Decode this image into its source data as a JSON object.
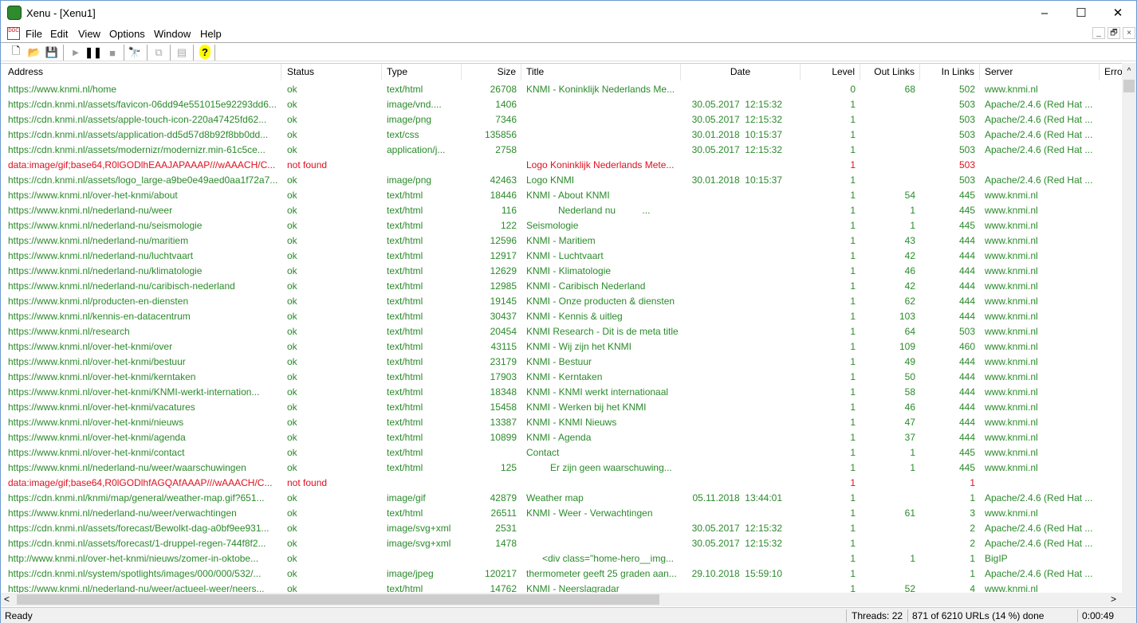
{
  "window": {
    "title": "Xenu - [Xenu1]",
    "minimize": "–",
    "maximize": "☐",
    "close": "✕"
  },
  "menu": [
    "File",
    "Edit",
    "View",
    "Options",
    "Window",
    "Help"
  ],
  "mdi": {
    "minimize": "_",
    "restore": "🗗",
    "close": "×"
  },
  "toolbar": [
    "new-icon",
    "open-icon",
    "save-icon",
    "play-icon",
    "pause-icon",
    "stop-icon",
    "find-icon",
    "copy-icon",
    "properties-icon",
    "help-icon"
  ],
  "columns": [
    "Address",
    "Status",
    "Type",
    "Size",
    "Title",
    "Date",
    "Level",
    "Out Links",
    "In Links",
    "Server",
    "Erro"
  ],
  "colors": {
    "ok": "#2b8a2b",
    "error": "#e0101e"
  },
  "rows": [
    {
      "s": "ok",
      "address": "https://www.knmi.nl/home",
      "status": "ok",
      "type": "text/html",
      "size": "26708",
      "title": "KNMI - Koninklijk Nederlands Me...",
      "date": "",
      "level": "0",
      "out": "68",
      "in": "502",
      "server": "www.knmi.nl"
    },
    {
      "s": "ok",
      "address": "https://cdn.knmi.nl/assets/favicon-06dd94e551015e92293dd6...",
      "status": "ok",
      "type": "image/vnd....",
      "size": "1406",
      "title": "",
      "date": "30.05.2017  12:15:32",
      "level": "1",
      "out": "",
      "in": "503",
      "server": "Apache/2.4.6 (Red Hat ..."
    },
    {
      "s": "ok",
      "address": "https://cdn.knmi.nl/assets/apple-touch-icon-220a47425fd62...",
      "status": "ok",
      "type": "image/png",
      "size": "7346",
      "title": "",
      "date": "30.05.2017  12:15:32",
      "level": "1",
      "out": "",
      "in": "503",
      "server": "Apache/2.4.6 (Red Hat ..."
    },
    {
      "s": "ok",
      "address": "https://cdn.knmi.nl/assets/application-dd5d57d8b92f8bb0dd...",
      "status": "ok",
      "type": "text/css",
      "size": "135856",
      "title": "",
      "date": "30.01.2018  10:15:37",
      "level": "1",
      "out": "",
      "in": "503",
      "server": "Apache/2.4.6 (Red Hat ..."
    },
    {
      "s": "ok",
      "address": "https://cdn.knmi.nl/assets/modernizr/modernizr.min-61c5ce...",
      "status": "ok",
      "type": "application/j...",
      "size": "2758",
      "title": "",
      "date": "30.05.2017  12:15:32",
      "level": "1",
      "out": "",
      "in": "503",
      "server": "Apache/2.4.6 (Red Hat ..."
    },
    {
      "s": "err",
      "address": "data:image/gif;base64,R0lGODlhEAAJAPAAAP///wAAACH/C...",
      "status": "not found",
      "type": "",
      "size": "",
      "title": "Logo Koninklijk Nederlands Mete...",
      "date": "",
      "level": "1",
      "out": "",
      "in": "503",
      "server": ""
    },
    {
      "s": "ok",
      "address": "https://cdn.knmi.nl/assets/logo_large-a9be0e49aed0aa1f72a7...",
      "status": "ok",
      "type": "image/png",
      "size": "42463",
      "title": "Logo KNMI",
      "date": "30.01.2018  10:15:37",
      "level": "1",
      "out": "",
      "in": "503",
      "server": "Apache/2.4.6 (Red Hat ..."
    },
    {
      "s": "ok",
      "address": "https://www.knmi.nl/over-het-knmi/about",
      "status": "ok",
      "type": "text/html",
      "size": "18446",
      "title": "KNMI - About KNMI",
      "date": "",
      "level": "1",
      "out": "54",
      "in": "445",
      "server": "www.knmi.nl"
    },
    {
      "s": "ok",
      "address": "https://www.knmi.nl/nederland-nu/weer",
      "status": "ok",
      "type": "text/html",
      "size": "116",
      "title": "            Nederland nu          ...",
      "date": "",
      "level": "1",
      "out": "1",
      "in": "445",
      "server": "www.knmi.nl"
    },
    {
      "s": "ok",
      "address": "https://www.knmi.nl/nederland-nu/seismologie",
      "status": "ok",
      "type": "text/html",
      "size": "122",
      "title": "Seismologie",
      "date": "",
      "level": "1",
      "out": "1",
      "in": "445",
      "server": "www.knmi.nl"
    },
    {
      "s": "ok",
      "address": "https://www.knmi.nl/nederland-nu/maritiem",
      "status": "ok",
      "type": "text/html",
      "size": "12596",
      "title": "KNMI - Maritiem",
      "date": "",
      "level": "1",
      "out": "43",
      "in": "444",
      "server": "www.knmi.nl"
    },
    {
      "s": "ok",
      "address": "https://www.knmi.nl/nederland-nu/luchtvaart",
      "status": "ok",
      "type": "text/html",
      "size": "12917",
      "title": "KNMI - Luchtvaart",
      "date": "",
      "level": "1",
      "out": "42",
      "in": "444",
      "server": "www.knmi.nl"
    },
    {
      "s": "ok",
      "address": "https://www.knmi.nl/nederland-nu/klimatologie",
      "status": "ok",
      "type": "text/html",
      "size": "12629",
      "title": "KNMI - Klimatologie",
      "date": "",
      "level": "1",
      "out": "46",
      "in": "444",
      "server": "www.knmi.nl"
    },
    {
      "s": "ok",
      "address": "https://www.knmi.nl/nederland-nu/caribisch-nederland",
      "status": "ok",
      "type": "text/html",
      "size": "12985",
      "title": "KNMI - Caribisch Nederland",
      "date": "",
      "level": "1",
      "out": "42",
      "in": "444",
      "server": "www.knmi.nl"
    },
    {
      "s": "ok",
      "address": "https://www.knmi.nl/producten-en-diensten",
      "status": "ok",
      "type": "text/html",
      "size": "19145",
      "title": "KNMI - Onze producten & diensten",
      "date": "",
      "level": "1",
      "out": "62",
      "in": "444",
      "server": "www.knmi.nl"
    },
    {
      "s": "ok",
      "address": "https://www.knmi.nl/kennis-en-datacentrum",
      "status": "ok",
      "type": "text/html",
      "size": "30437",
      "title": "KNMI - Kennis & uitleg",
      "date": "",
      "level": "1",
      "out": "103",
      "in": "444",
      "server": "www.knmi.nl"
    },
    {
      "s": "ok",
      "address": "https://www.knmi.nl/research",
      "status": "ok",
      "type": "text/html",
      "size": "20454",
      "title": "KNMI Research - Dit is de meta title",
      "date": "",
      "level": "1",
      "out": "64",
      "in": "503",
      "server": "www.knmi.nl"
    },
    {
      "s": "ok",
      "address": "https://www.knmi.nl/over-het-knmi/over",
      "status": "ok",
      "type": "text/html",
      "size": "43115",
      "title": "KNMI - Wij zijn het KNMI",
      "date": "",
      "level": "1",
      "out": "109",
      "in": "460",
      "server": "www.knmi.nl"
    },
    {
      "s": "ok",
      "address": "https://www.knmi.nl/over-het-knmi/bestuur",
      "status": "ok",
      "type": "text/html",
      "size": "23179",
      "title": "KNMI - Bestuur",
      "date": "",
      "level": "1",
      "out": "49",
      "in": "444",
      "server": "www.knmi.nl"
    },
    {
      "s": "ok",
      "address": "https://www.knmi.nl/over-het-knmi/kerntaken",
      "status": "ok",
      "type": "text/html",
      "size": "17903",
      "title": "KNMI - Kerntaken",
      "date": "",
      "level": "1",
      "out": "50",
      "in": "444",
      "server": "www.knmi.nl"
    },
    {
      "s": "ok",
      "address": "https://www.knmi.nl/over-het-knmi/KNMI-werkt-internation...",
      "status": "ok",
      "type": "text/html",
      "size": "18348",
      "title": "KNMI - KNMI werkt internationaal",
      "date": "",
      "level": "1",
      "out": "58",
      "in": "444",
      "server": "www.knmi.nl"
    },
    {
      "s": "ok",
      "address": "https://www.knmi.nl/over-het-knmi/vacatures",
      "status": "ok",
      "type": "text/html",
      "size": "15458",
      "title": "KNMI - Werken bij het KNMI",
      "date": "",
      "level": "1",
      "out": "46",
      "in": "444",
      "server": "www.knmi.nl"
    },
    {
      "s": "ok",
      "address": "https://www.knmi.nl/over-het-knmi/nieuws",
      "status": "ok",
      "type": "text/html",
      "size": "13387",
      "title": "KNMI - KNMI Nieuws",
      "date": "",
      "level": "1",
      "out": "47",
      "in": "444",
      "server": "www.knmi.nl"
    },
    {
      "s": "ok",
      "address": "https://www.knmi.nl/over-het-knmi/agenda",
      "status": "ok",
      "type": "text/html",
      "size": "10899",
      "title": "KNMI - Agenda",
      "date": "",
      "level": "1",
      "out": "37",
      "in": "444",
      "server": "www.knmi.nl"
    },
    {
      "s": "ok",
      "address": "https://www.knmi.nl/over-het-knmi/contact",
      "status": "ok",
      "type": "text/html",
      "size": "",
      "title": "Contact",
      "date": "",
      "level": "1",
      "out": "1",
      "in": "445",
      "server": "www.knmi.nl"
    },
    {
      "s": "ok",
      "address": "https://www.knmi.nl/nederland-nu/weer/waarschuwingen",
      "status": "ok",
      "type": "text/html",
      "size": "125",
      "title": "         Er zijn geen waarschuwing...",
      "date": "",
      "level": "1",
      "out": "1",
      "in": "445",
      "server": "www.knmi.nl"
    },
    {
      "s": "err",
      "address": "data:image/gif;base64,R0lGODlhfAGQAfAAAP///wAAACH/C...",
      "status": "not found",
      "type": "",
      "size": "",
      "title": "",
      "date": "",
      "level": "1",
      "out": "",
      "in": "1",
      "server": ""
    },
    {
      "s": "ok",
      "address": "https://cdn.knmi.nl/knmi/map/general/weather-map.gif?651...",
      "status": "ok",
      "type": "image/gif",
      "size": "42879",
      "title": "Weather map",
      "date": "05.11.2018  13:44:01",
      "level": "1",
      "out": "",
      "in": "1",
      "server": "Apache/2.4.6 (Red Hat ..."
    },
    {
      "s": "ok",
      "address": "https://www.knmi.nl/nederland-nu/weer/verwachtingen",
      "status": "ok",
      "type": "text/html",
      "size": "26511",
      "title": "KNMI - Weer - Verwachtingen",
      "date": "",
      "level": "1",
      "out": "61",
      "in": "3",
      "server": "www.knmi.nl"
    },
    {
      "s": "ok",
      "address": "https://cdn.knmi.nl/assets/forecast/Bewolkt-dag-a0bf9ee931...",
      "status": "ok",
      "type": "image/svg+xml",
      "size": "2531",
      "title": "",
      "date": "30.05.2017  12:15:32",
      "level": "1",
      "out": "",
      "in": "2",
      "server": "Apache/2.4.6 (Red Hat ..."
    },
    {
      "s": "ok",
      "address": "https://cdn.knmi.nl/assets/forecast/1-druppel-regen-744f8f2...",
      "status": "ok",
      "type": "image/svg+xml",
      "size": "1478",
      "title": "",
      "date": "30.05.2017  12:15:32",
      "level": "1",
      "out": "",
      "in": "2",
      "server": "Apache/2.4.6 (Red Hat ..."
    },
    {
      "s": "ok",
      "address": "http://www.knmi.nl/over-het-knmi/nieuws/zomer-in-oktobe...",
      "status": "ok",
      "type": "",
      "size": "",
      "title": "      <div class=\"home-hero__img...",
      "date": "",
      "level": "1",
      "out": "1",
      "in": "1",
      "server": "BigIP"
    },
    {
      "s": "ok",
      "address": "https://cdn.knmi.nl/system/spotlights/images/000/000/532/...",
      "status": "ok",
      "type": "image/jpeg",
      "size": "120217",
      "title": "thermometer geeft 25 graden aan...",
      "date": "29.10.2018  15:59:10",
      "level": "1",
      "out": "",
      "in": "1",
      "server": "Apache/2.4.6 (Red Hat ..."
    },
    {
      "s": "ok",
      "address": "https://www.knmi.nl/nederland-nu/weer/actueel-weer/neers...",
      "status": "ok",
      "type": "text/html",
      "size": "14762",
      "title": "KNMI - Neerslagradar",
      "date": "",
      "level": "1",
      "out": "52",
      "in": "4",
      "server": "www.knmi.nl"
    }
  ],
  "status": {
    "ready": "Ready",
    "threads": "Threads: 22",
    "progress": "871 of 6210 URLs (14 %) done",
    "progress_percent": 14,
    "elapsed": "0:00:49"
  },
  "scroll": {
    "left": "<",
    "right": ">",
    "up": "^"
  }
}
